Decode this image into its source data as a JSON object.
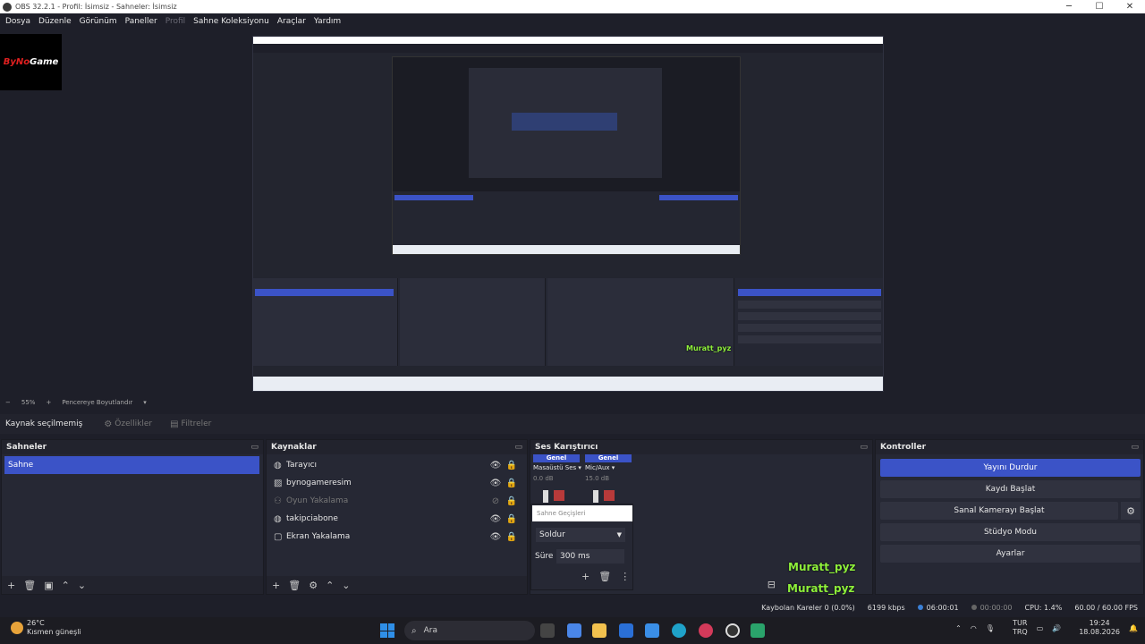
{
  "window": {
    "title": "OBS 32.2.1 - Profil: İsimsiz - Sahneler: İsimsiz",
    "minimize": "─",
    "maximize": "☐",
    "close": "✕"
  },
  "menu": [
    "Dosya",
    "Düzenle",
    "Görünüm",
    "Paneller",
    "Profil",
    "Sahne Koleksiyonu",
    "Araçlar",
    "Yardım"
  ],
  "logo": {
    "text_a": "ByNo",
    "text_b": "Game"
  },
  "zoom": {
    "minus": "−",
    "level": "55%",
    "plus": "+",
    "fit": "Pencereye Boyutlandır"
  },
  "source_toolbar": {
    "no_selection": "Kaynak seçilmemiş",
    "properties": "Özellikler",
    "filters": "Filtreler"
  },
  "scenes": {
    "title": "Sahneler",
    "items": [
      "Sahne"
    ]
  },
  "sources": {
    "title": "Kaynaklar",
    "items": [
      {
        "name": "Tarayıcı",
        "icon": "globe-icon"
      },
      {
        "name": "bynogameresim",
        "icon": "image-icon"
      },
      {
        "name": "Oyun Yakalama",
        "icon": "gamepad-icon"
      },
      {
        "name": "takipciabone",
        "icon": "globe-icon"
      },
      {
        "name": "Ekran Yakalama",
        "icon": "monitor-icon"
      }
    ]
  },
  "mixer": {
    "title": "Ses Karıştırıcı",
    "channels": [
      {
        "head": "Genel",
        "name": "Masaüstü Ses",
        "db": "0.0 dB"
      },
      {
        "head": "Genel",
        "name": "Mic/Aux",
        "db": "15.0 dB"
      }
    ]
  },
  "transitions": {
    "title": "Sahne Geçişleri",
    "selected": "Soldur",
    "duration_label": "Süre",
    "duration": "300 ms"
  },
  "controls": {
    "title": "Kontroller",
    "stop_stream": "Yayını Durdur",
    "start_record": "Kaydı Başlat",
    "virtual_cam": "Sanal Kamerayı Başlat",
    "studio_mode": "Stüdyo Modu",
    "settings": "Ayarlar"
  },
  "chat": {
    "username": "Muratt_pyz"
  },
  "status": {
    "dropped": "Kaybolan Kareler 0 (0.0%)",
    "bitrate": "6199 kbps",
    "stream_time": "06:00:01",
    "record_time": "00:00:00",
    "cpu": "CPU: 1.4%",
    "fps": "60.00 / 60.00 FPS"
  },
  "taskbar": {
    "weather_temp": "26°C",
    "weather_desc": "Kısmen güneşli",
    "search": "Ara",
    "lang": "TUR",
    "lang2": "TRQ",
    "time": "19:24",
    "date": "18.08.2026"
  },
  "colors": {
    "accent": "#3b53c7",
    "background": "#1e1f29",
    "panel": "#262834"
  }
}
